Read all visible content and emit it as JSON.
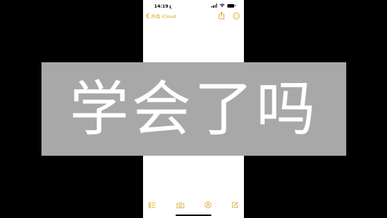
{
  "status_bar": {
    "time": "14:19"
  },
  "nav": {
    "back_label": "所有 iCloud",
    "accent_color": "#d6a21a",
    "actions": [
      "share-icon",
      "more-icon"
    ]
  },
  "banner": {
    "text": "学会了吗",
    "background": "#a8a8a8"
  },
  "toolbar": {
    "items": [
      "checklist-icon",
      "camera-icon",
      "markup-icon",
      "compose-icon"
    ]
  }
}
